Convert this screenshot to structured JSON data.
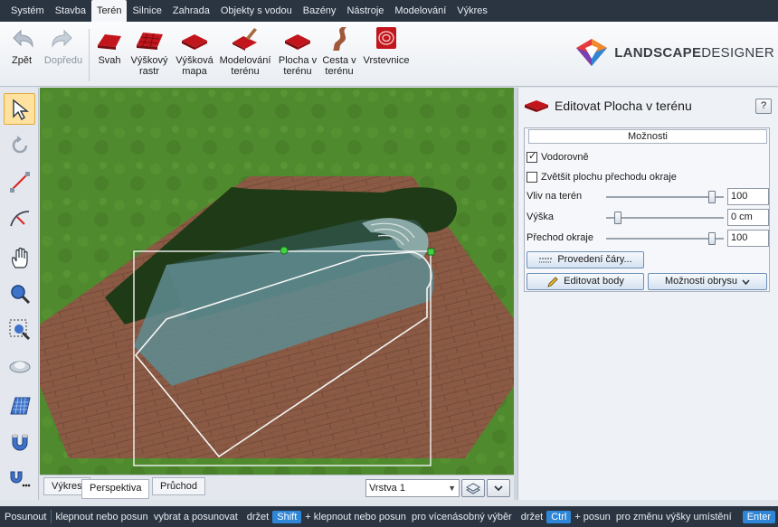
{
  "menubar": {
    "items": [
      "Systém",
      "Stavba",
      "Terén",
      "Silnice",
      "Zahrada",
      "Objekty s vodou",
      "Bazény",
      "Nástroje",
      "Modelování",
      "Výkres"
    ],
    "active_index": 2
  },
  "ribbon": {
    "undo": "Zpět",
    "redo": "Dopředu",
    "tools": [
      {
        "label": "Svah",
        "icon": "slope-icon"
      },
      {
        "label": "Výškový rastr",
        "icon": "height-grid-icon"
      },
      {
        "label": "Výšková mapa",
        "icon": "height-map-icon"
      },
      {
        "label": "Modelování terénu",
        "icon": "terrain-modeling-icon"
      },
      {
        "label": "Plocha v terénu",
        "icon": "terrain-area-icon"
      },
      {
        "label": "Cesta v terénu",
        "icon": "terrain-path-icon"
      },
      {
        "label": "Vrstevnice",
        "icon": "contour-icon"
      }
    ],
    "logo": {
      "bold": "LANDSCAPE",
      "light": "DESIGNER"
    }
  },
  "view_tabs": {
    "tabs": [
      "Výkres",
      "Perspektiva",
      "Průchod"
    ],
    "active_index": 1,
    "layer": "Vrstva 1"
  },
  "panel": {
    "title": "Editovat Plocha v terénu",
    "help": "?",
    "options_title": "Možnosti",
    "horizontal": {
      "label": "Vodorovně",
      "checked": true
    },
    "enlarge_edge": {
      "label": "Zvětšit plochu přechodu okraje",
      "checked": false
    },
    "sliders": [
      {
        "label": "Vliv na terén",
        "value": "100",
        "fraction": 0.9
      },
      {
        "label": "Výška",
        "value": "0 cm",
        "fraction": 0.1
      },
      {
        "label": "Přechod okraje",
        "value": "100",
        "fraction": 0.9
      }
    ],
    "line_style_button": "Provedení čáry...",
    "edit_points_button": "Editovat body",
    "outline_options_button": "Možnosti obrysu"
  },
  "statusbar": {
    "mode": "Posunout",
    "part1": "klepnout nebo posun",
    "part1b": "vybrat a posunovat",
    "hold1": "držet",
    "key1": "Shift",
    "part2": "+ klepnout nebo posun",
    "part2b": "pro vícenásobný výběr",
    "hold2": "držet",
    "key2": "Ctrl",
    "part3": "+ posun",
    "part3b": "pro změnu výšky umístění",
    "key3": "Enter"
  },
  "colors": {
    "menubar": "#2b3542",
    "accent": "#2f86d6",
    "grass": "#4f8a2e",
    "pavement": "#8a5a44",
    "water": "#5f8a8e"
  }
}
